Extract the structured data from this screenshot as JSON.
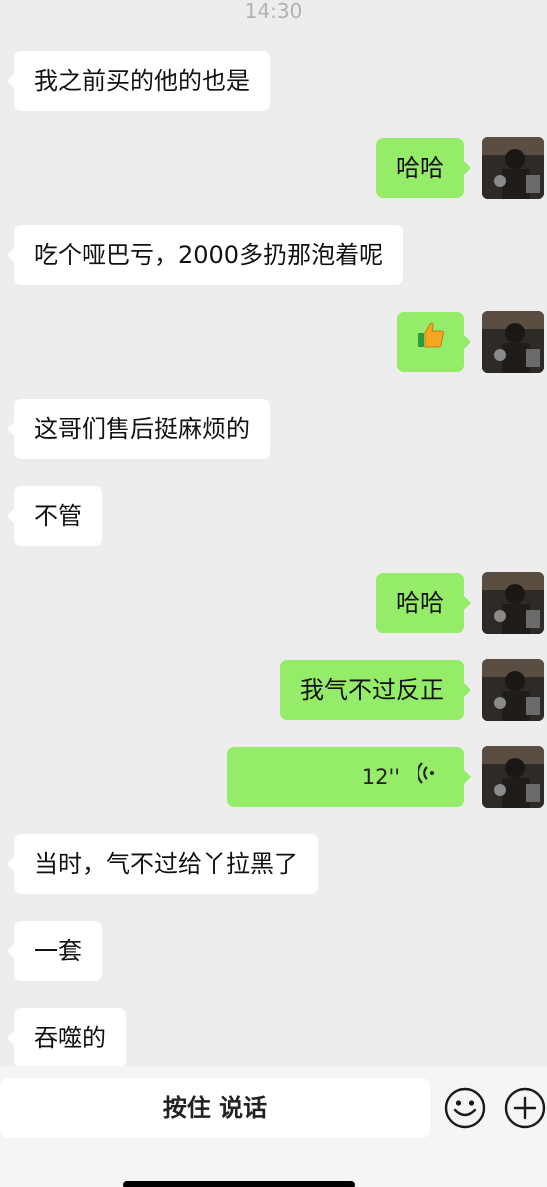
{
  "status": {
    "time": "14:30"
  },
  "messages": [
    {
      "side": "left",
      "text": "我之前买的他的也是"
    },
    {
      "side": "right",
      "text": "哈哈"
    },
    {
      "side": "left",
      "text": "吃个哑巴亏，2000多扔那泡着呢"
    },
    {
      "side": "right",
      "type": "emoji",
      "icon": "thumbs-up-icon"
    },
    {
      "side": "left",
      "text": "这哥们售后挺麻烦的"
    },
    {
      "side": "left",
      "text": "不管"
    },
    {
      "side": "right",
      "text": "哈哈"
    },
    {
      "side": "right",
      "text": "我气不过反正"
    },
    {
      "side": "right",
      "type": "voice",
      "duration": "12''"
    },
    {
      "side": "left",
      "text": "当时，气不过给丫拉黑了"
    },
    {
      "side": "left",
      "text": "一套"
    },
    {
      "side": "left",
      "text": "吞噬的"
    }
  ],
  "input_bar": {
    "talk_label": "按住 说话",
    "emoji_icon": "emoji-icon",
    "plus_icon": "plus-icon"
  },
  "colors": {
    "background": "#ededed",
    "sent_bubble": "#95ec69",
    "received_bubble": "#ffffff"
  }
}
